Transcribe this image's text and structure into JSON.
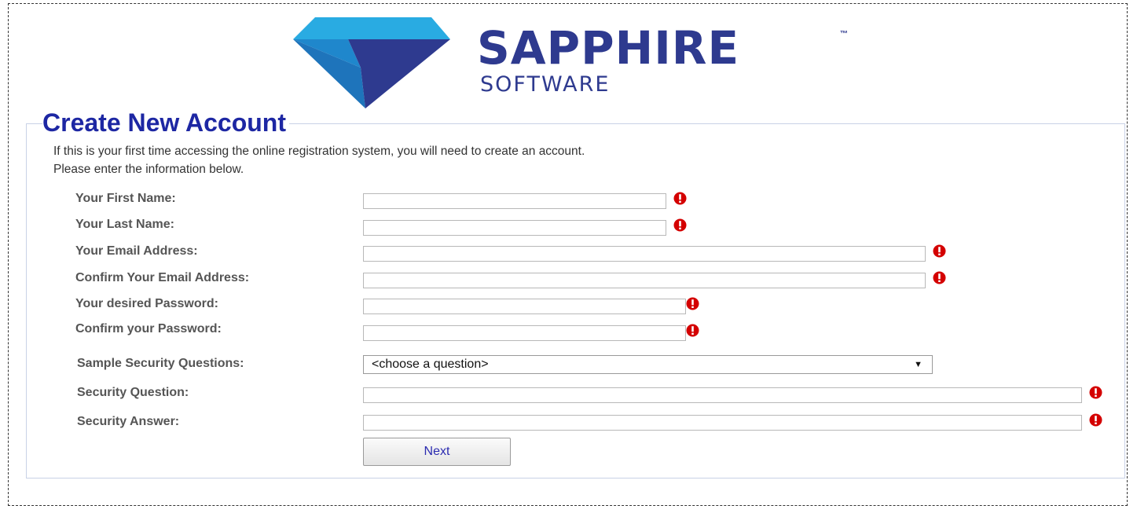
{
  "brand": {
    "name": "SAPPHIRE",
    "trademark": "™",
    "tagline": "SOFTWARE",
    "colors": {
      "light": "#29abe2",
      "mid": "#1e74bb",
      "dark": "#2e3a8f"
    }
  },
  "form": {
    "title": "Create New Account",
    "intro_line1": "If this is your first time accessing the online registration system, you will need to create an account.",
    "intro_line2": "Please enter the information below.",
    "fields": {
      "first_name": {
        "label": "Your First Name:",
        "value": ""
      },
      "last_name": {
        "label": "Your Last Name:",
        "value": ""
      },
      "email": {
        "label": "Your Email Address:",
        "value": ""
      },
      "confirm_email": {
        "label": "Confirm Your Email Address:",
        "value": ""
      },
      "password": {
        "label": "Your desired Password:",
        "value": ""
      },
      "confirm_password": {
        "label": "Confirm your Password:",
        "value": ""
      },
      "sample_questions": {
        "label": "Sample Security Questions:",
        "selected": "<choose a question>"
      },
      "security_question": {
        "label": "Security Question:",
        "value": ""
      },
      "security_answer": {
        "label": "Security Answer:",
        "value": ""
      }
    },
    "next_label": "Next",
    "required_icon": "exclamation-required-icon",
    "required_color": "#d40000"
  }
}
